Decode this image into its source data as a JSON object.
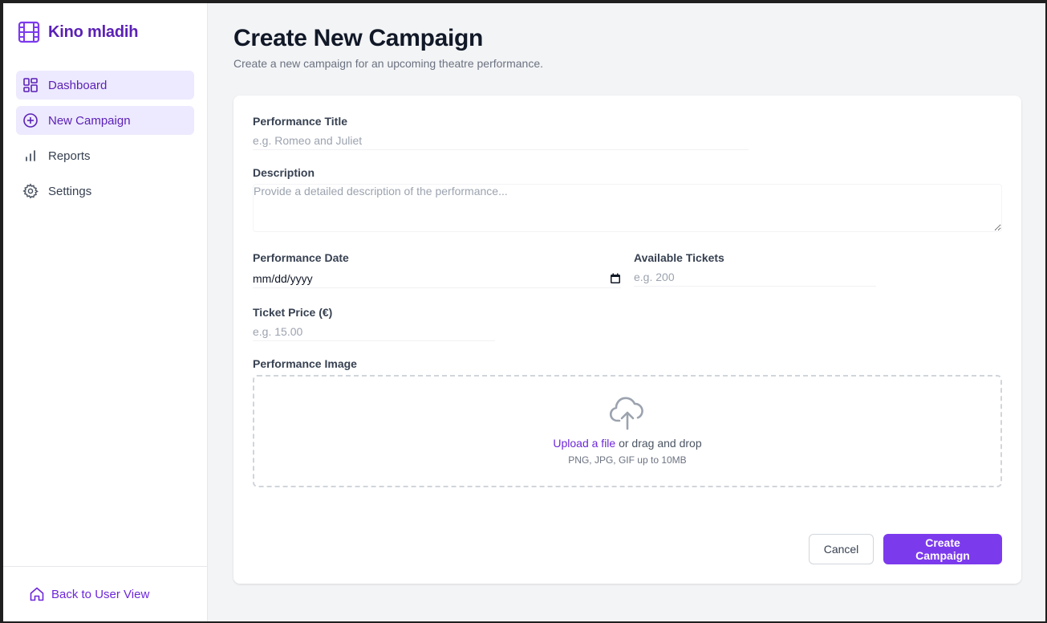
{
  "app": {
    "name": "Kino mladih",
    "brand_icon": "film-icon",
    "accent": "#7c3aed"
  },
  "sidebar": {
    "items": [
      {
        "label": "Dashboard",
        "icon": "dashboard-grid-icon",
        "active": true
      },
      {
        "label": "New Campaign",
        "icon": "plus-circle-icon",
        "active": true
      },
      {
        "label": "Reports",
        "icon": "bar-chart-icon",
        "active": false
      },
      {
        "label": "Settings",
        "icon": "gear-icon",
        "active": false
      }
    ],
    "footer": {
      "label": "Back to User View",
      "icon": "home-icon"
    }
  },
  "page": {
    "title": "Create New Campaign",
    "subtitle": "Create a new campaign for an upcoming theatre performance."
  },
  "form": {
    "title": {
      "label": "Performance Title",
      "placeholder": "e.g. Romeo and Juliet"
    },
    "description": {
      "label": "Description",
      "placeholder": "Provide a detailed description of the performance..."
    },
    "date": {
      "label": "Performance Date",
      "value": "mm/dd/yyyy",
      "icon": "calendar-icon"
    },
    "tickets": {
      "label": "Available Tickets",
      "placeholder": "e.g. 200"
    },
    "price": {
      "label": "Ticket Price (€)",
      "placeholder": "e.g. 15.00"
    },
    "image": {
      "label": "Performance Image",
      "icon": "cloud-upload-icon",
      "link_text": "Upload a file",
      "rest_text": " or drag and drop",
      "hint": "PNG, JPG, GIF up to 10MB"
    },
    "actions": {
      "cancel": "Cancel",
      "submit": "Create Campaign"
    }
  }
}
